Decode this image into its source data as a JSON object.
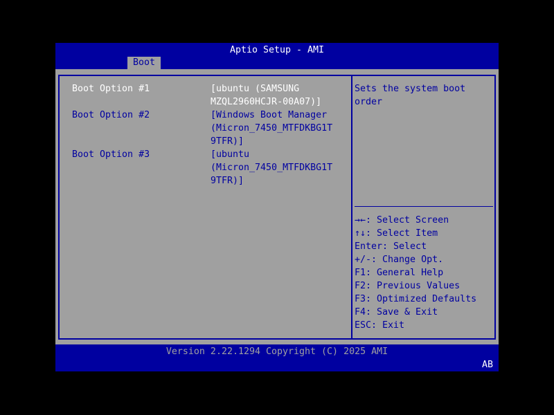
{
  "header": {
    "title": "Aptio Setup - AMI",
    "tabs": [
      {
        "label": "Boot",
        "active": true
      }
    ]
  },
  "boot_options": [
    {
      "label": "Boot Option #1",
      "value_lines": [
        "[ubuntu (SAMSUNG",
        "MZQL2960HCJR-00A07)]"
      ],
      "selected": true
    },
    {
      "label": "Boot Option #2",
      "value_lines": [
        "[Windows Boot Manager",
        "(Micron_7450_MTFDKBG1T",
        "9TFR)]"
      ],
      "selected": false
    },
    {
      "label": "Boot Option #3",
      "value_lines": [
        "[ubuntu",
        "(Micron_7450_MTFDKBG1T",
        "9TFR)]"
      ],
      "selected": false
    }
  ],
  "help": {
    "lines": [
      "Sets the system boot",
      "order"
    ]
  },
  "keys": [
    "→←: Select Screen",
    "↑↓: Select Item",
    "Enter: Select",
    "+/-: Change Opt.",
    "F1: General Help",
    "F2: Previous Values",
    "F3: Optimized Defaults",
    "F4: Save & Exit",
    "ESC: Exit"
  ],
  "footer": {
    "version": "Version 2.22.1294 Copyright (C) 2025 AMI",
    "indicator": "AB"
  },
  "colors": {
    "blue": "#0000a0",
    "gray": "#a0a0a0",
    "selected": "#ffffff"
  }
}
